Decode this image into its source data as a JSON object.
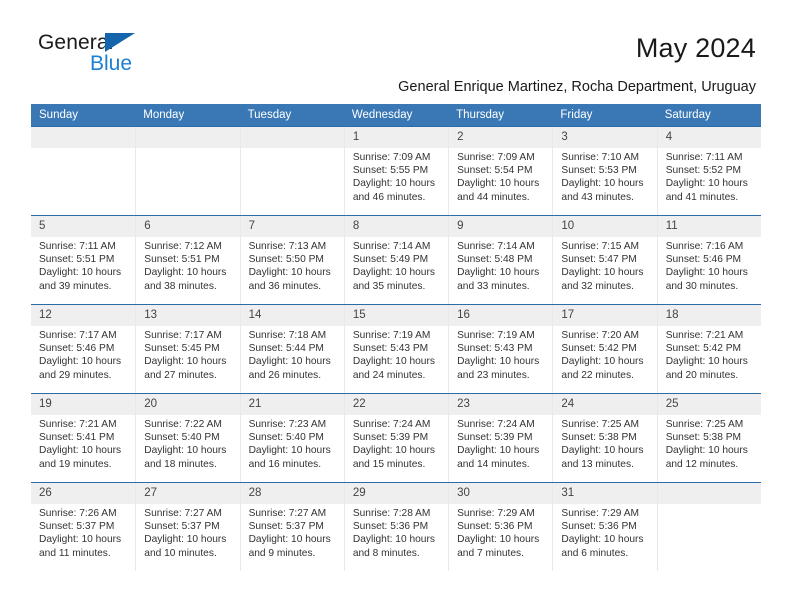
{
  "brand": {
    "name_part1": "General",
    "name_part2": "Blue"
  },
  "header": {
    "title": "May 2024",
    "subtitle": "General Enrique Martinez, Rocha Department, Uruguay"
  },
  "colors": {
    "header_blue": "#3a78b5",
    "rule_blue": "#2b6ca8",
    "daynum_gray": "#efefef",
    "brand_blue": "#1b7fd4"
  },
  "weekday_headers": [
    "Sunday",
    "Monday",
    "Tuesday",
    "Wednesday",
    "Thursday",
    "Friday",
    "Saturday"
  ],
  "labels": {
    "sunrise": "Sunrise:",
    "sunset": "Sunset:",
    "daylight": "Daylight:"
  },
  "weeks": [
    [
      {
        "day": "",
        "sunrise": "",
        "sunset": "",
        "daylight_line1": "",
        "daylight_line2": ""
      },
      {
        "day": "",
        "sunrise": "",
        "sunset": "",
        "daylight_line1": "",
        "daylight_line2": ""
      },
      {
        "day": "",
        "sunrise": "",
        "sunset": "",
        "daylight_line1": "",
        "daylight_line2": ""
      },
      {
        "day": "1",
        "sunrise": "Sunrise: 7:09 AM",
        "sunset": "Sunset: 5:55 PM",
        "daylight_line1": "Daylight: 10 hours",
        "daylight_line2": "and 46 minutes."
      },
      {
        "day": "2",
        "sunrise": "Sunrise: 7:09 AM",
        "sunset": "Sunset: 5:54 PM",
        "daylight_line1": "Daylight: 10 hours",
        "daylight_line2": "and 44 minutes."
      },
      {
        "day": "3",
        "sunrise": "Sunrise: 7:10 AM",
        "sunset": "Sunset: 5:53 PM",
        "daylight_line1": "Daylight: 10 hours",
        "daylight_line2": "and 43 minutes."
      },
      {
        "day": "4",
        "sunrise": "Sunrise: 7:11 AM",
        "sunset": "Sunset: 5:52 PM",
        "daylight_line1": "Daylight: 10 hours",
        "daylight_line2": "and 41 minutes."
      }
    ],
    [
      {
        "day": "5",
        "sunrise": "Sunrise: 7:11 AM",
        "sunset": "Sunset: 5:51 PM",
        "daylight_line1": "Daylight: 10 hours",
        "daylight_line2": "and 39 minutes."
      },
      {
        "day": "6",
        "sunrise": "Sunrise: 7:12 AM",
        "sunset": "Sunset: 5:51 PM",
        "daylight_line1": "Daylight: 10 hours",
        "daylight_line2": "and 38 minutes."
      },
      {
        "day": "7",
        "sunrise": "Sunrise: 7:13 AM",
        "sunset": "Sunset: 5:50 PM",
        "daylight_line1": "Daylight: 10 hours",
        "daylight_line2": "and 36 minutes."
      },
      {
        "day": "8",
        "sunrise": "Sunrise: 7:14 AM",
        "sunset": "Sunset: 5:49 PM",
        "daylight_line1": "Daylight: 10 hours",
        "daylight_line2": "and 35 minutes."
      },
      {
        "day": "9",
        "sunrise": "Sunrise: 7:14 AM",
        "sunset": "Sunset: 5:48 PM",
        "daylight_line1": "Daylight: 10 hours",
        "daylight_line2": "and 33 minutes."
      },
      {
        "day": "10",
        "sunrise": "Sunrise: 7:15 AM",
        "sunset": "Sunset: 5:47 PM",
        "daylight_line1": "Daylight: 10 hours",
        "daylight_line2": "and 32 minutes."
      },
      {
        "day": "11",
        "sunrise": "Sunrise: 7:16 AM",
        "sunset": "Sunset: 5:46 PM",
        "daylight_line1": "Daylight: 10 hours",
        "daylight_line2": "and 30 minutes."
      }
    ],
    [
      {
        "day": "12",
        "sunrise": "Sunrise: 7:17 AM",
        "sunset": "Sunset: 5:46 PM",
        "daylight_line1": "Daylight: 10 hours",
        "daylight_line2": "and 29 minutes."
      },
      {
        "day": "13",
        "sunrise": "Sunrise: 7:17 AM",
        "sunset": "Sunset: 5:45 PM",
        "daylight_line1": "Daylight: 10 hours",
        "daylight_line2": "and 27 minutes."
      },
      {
        "day": "14",
        "sunrise": "Sunrise: 7:18 AM",
        "sunset": "Sunset: 5:44 PM",
        "daylight_line1": "Daylight: 10 hours",
        "daylight_line2": "and 26 minutes."
      },
      {
        "day": "15",
        "sunrise": "Sunrise: 7:19 AM",
        "sunset": "Sunset: 5:43 PM",
        "daylight_line1": "Daylight: 10 hours",
        "daylight_line2": "and 24 minutes."
      },
      {
        "day": "16",
        "sunrise": "Sunrise: 7:19 AM",
        "sunset": "Sunset: 5:43 PM",
        "daylight_line1": "Daylight: 10 hours",
        "daylight_line2": "and 23 minutes."
      },
      {
        "day": "17",
        "sunrise": "Sunrise: 7:20 AM",
        "sunset": "Sunset: 5:42 PM",
        "daylight_line1": "Daylight: 10 hours",
        "daylight_line2": "and 22 minutes."
      },
      {
        "day": "18",
        "sunrise": "Sunrise: 7:21 AM",
        "sunset": "Sunset: 5:42 PM",
        "daylight_line1": "Daylight: 10 hours",
        "daylight_line2": "and 20 minutes."
      }
    ],
    [
      {
        "day": "19",
        "sunrise": "Sunrise: 7:21 AM",
        "sunset": "Sunset: 5:41 PM",
        "daylight_line1": "Daylight: 10 hours",
        "daylight_line2": "and 19 minutes."
      },
      {
        "day": "20",
        "sunrise": "Sunrise: 7:22 AM",
        "sunset": "Sunset: 5:40 PM",
        "daylight_line1": "Daylight: 10 hours",
        "daylight_line2": "and 18 minutes."
      },
      {
        "day": "21",
        "sunrise": "Sunrise: 7:23 AM",
        "sunset": "Sunset: 5:40 PM",
        "daylight_line1": "Daylight: 10 hours",
        "daylight_line2": "and 16 minutes."
      },
      {
        "day": "22",
        "sunrise": "Sunrise: 7:24 AM",
        "sunset": "Sunset: 5:39 PM",
        "daylight_line1": "Daylight: 10 hours",
        "daylight_line2": "and 15 minutes."
      },
      {
        "day": "23",
        "sunrise": "Sunrise: 7:24 AM",
        "sunset": "Sunset: 5:39 PM",
        "daylight_line1": "Daylight: 10 hours",
        "daylight_line2": "and 14 minutes."
      },
      {
        "day": "24",
        "sunrise": "Sunrise: 7:25 AM",
        "sunset": "Sunset: 5:38 PM",
        "daylight_line1": "Daylight: 10 hours",
        "daylight_line2": "and 13 minutes."
      },
      {
        "day": "25",
        "sunrise": "Sunrise: 7:25 AM",
        "sunset": "Sunset: 5:38 PM",
        "daylight_line1": "Daylight: 10 hours",
        "daylight_line2": "and 12 minutes."
      }
    ],
    [
      {
        "day": "26",
        "sunrise": "Sunrise: 7:26 AM",
        "sunset": "Sunset: 5:37 PM",
        "daylight_line1": "Daylight: 10 hours",
        "daylight_line2": "and 11 minutes."
      },
      {
        "day": "27",
        "sunrise": "Sunrise: 7:27 AM",
        "sunset": "Sunset: 5:37 PM",
        "daylight_line1": "Daylight: 10 hours",
        "daylight_line2": "and 10 minutes."
      },
      {
        "day": "28",
        "sunrise": "Sunrise: 7:27 AM",
        "sunset": "Sunset: 5:37 PM",
        "daylight_line1": "Daylight: 10 hours",
        "daylight_line2": "and 9 minutes."
      },
      {
        "day": "29",
        "sunrise": "Sunrise: 7:28 AM",
        "sunset": "Sunset: 5:36 PM",
        "daylight_line1": "Daylight: 10 hours",
        "daylight_line2": "and 8 minutes."
      },
      {
        "day": "30",
        "sunrise": "Sunrise: 7:29 AM",
        "sunset": "Sunset: 5:36 PM",
        "daylight_line1": "Daylight: 10 hours",
        "daylight_line2": "and 7 minutes."
      },
      {
        "day": "31",
        "sunrise": "Sunrise: 7:29 AM",
        "sunset": "Sunset: 5:36 PM",
        "daylight_line1": "Daylight: 10 hours",
        "daylight_line2": "and 6 minutes."
      },
      {
        "day": "",
        "sunrise": "",
        "sunset": "",
        "daylight_line1": "",
        "daylight_line2": ""
      }
    ]
  ]
}
